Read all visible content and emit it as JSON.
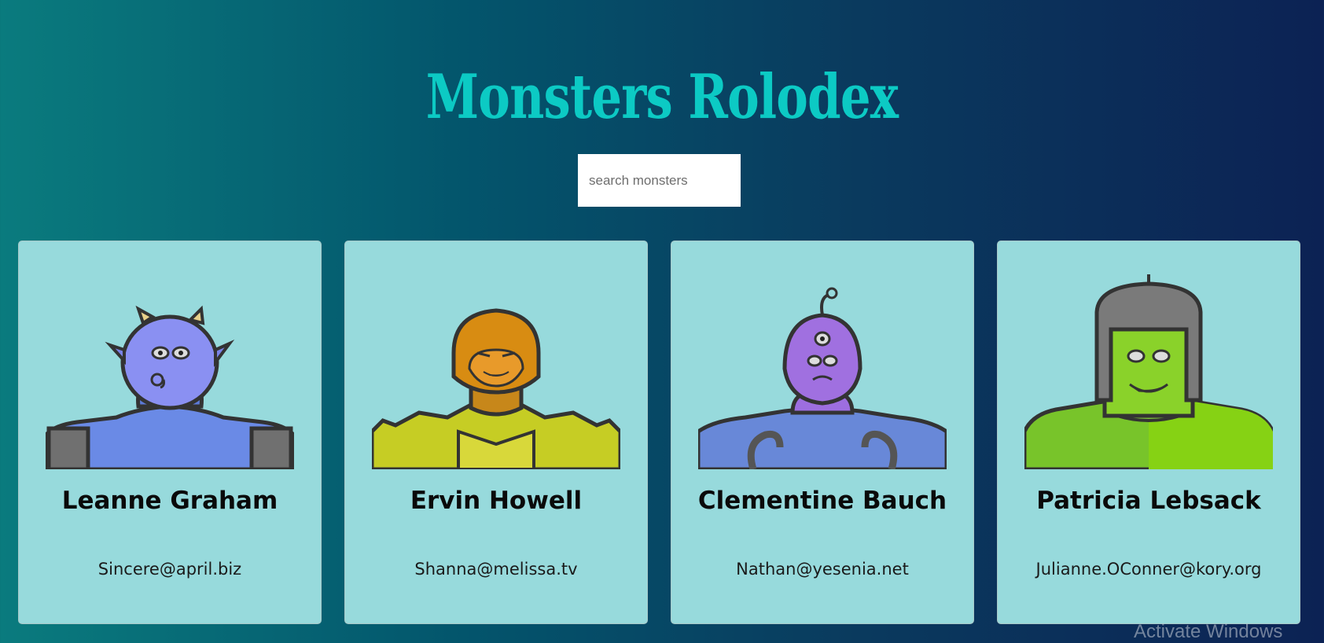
{
  "app": {
    "title": "Monsters Rolodex"
  },
  "search": {
    "placeholder": "search monsters"
  },
  "monsters": [
    {
      "name": "Leanne Graham",
      "email": "Sincere@april.biz",
      "color": "#7f8ff0"
    },
    {
      "name": "Ervin Howell",
      "email": "Shanna@melissa.tv",
      "color": "#d98a12"
    },
    {
      "name": "Clementine Bauch",
      "email": "Nathan@yesenia.net",
      "color": "#a070e0"
    },
    {
      "name": "Patricia Lebsack",
      "email": "Julianne.OConner@kory.org",
      "color": "#7fd321"
    }
  ],
  "watermark": "Activate Windows"
}
